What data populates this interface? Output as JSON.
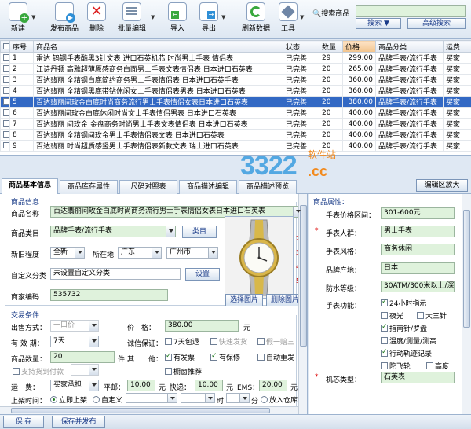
{
  "toolbar": {
    "buttons": [
      {
        "label": "新建",
        "icon": "new-icon"
      },
      {
        "label": "发布商品",
        "icon": "publish-icon"
      },
      {
        "label": "删除",
        "icon": "delete-icon"
      },
      {
        "label": "批量编辑",
        "icon": "batch-edit-icon"
      },
      {
        "label": "导入",
        "icon": "import-icon"
      },
      {
        "label": "导出",
        "icon": "export-icon"
      },
      {
        "label": "刷新数据",
        "icon": "refresh-icon"
      },
      {
        "label": "工具",
        "icon": "tools-icon"
      }
    ],
    "search_label": "搜索商品",
    "search_value": "",
    "search_button": "搜索",
    "advanced_search": "高级搜索"
  },
  "grid": {
    "columns": [
      "序号",
      "商品名",
      "状态",
      "数量",
      "价格",
      "商品分类",
      "运费"
    ],
    "rows": [
      {
        "no": "1",
        "name": "雷达 钨钢手表酷黑3针文表  进口石英机芯 时尚男士手表 情侣表",
        "status": "已完善",
        "qty": "29",
        "price": "299.00",
        "cat": "品牌手表/流行手表",
        "ship": "买家"
      },
      {
        "no": "2",
        "name": "江诗丹顿 高雅超薄原感商务白面男士手表文表情侣表 日本进口石英表",
        "status": "已完善",
        "qty": "20",
        "price": "265.00",
        "cat": "品牌手表/流行手表",
        "ship": "买家"
      },
      {
        "no": "3",
        "name": "百达翡丽 全精钢白底简约商务男士手表情侣表 日本进口石英手表",
        "status": "已完善",
        "qty": "20",
        "price": "360.00",
        "cat": "品牌手表/流行手表",
        "ship": "买家"
      },
      {
        "no": "4",
        "name": "百达翡丽 全精钢黑底带钻休闲女士手表情侣表男表 日本进口石英表",
        "status": "已完善",
        "qty": "20",
        "price": "360.00",
        "cat": "品牌手表/流行手表",
        "ship": "买家"
      },
      {
        "no": "5",
        "name": "百达翡丽间玫金白底时尚商务流行男士手表情侣女表日本进口石英表",
        "status": "已完善",
        "qty": "20",
        "price": "380.00",
        "cat": "品牌手表/流行手表",
        "ship": "买家"
      },
      {
        "no": "6",
        "name": "百达翡丽间玫金白底休闲时尚文士手表情侣男表 日本进口石英表",
        "status": "已完善",
        "qty": "20",
        "price": "400.00",
        "cat": "品牌手表/流行手表",
        "ship": "买家"
      },
      {
        "no": "7",
        "name": "百达翡丽 间玫金 金盘商务时尚男士手表文表情侣表 日本进口石英表",
        "status": "已完善",
        "qty": "20",
        "price": "400.00",
        "cat": "品牌手表/流行手表",
        "ship": "买家"
      },
      {
        "no": "8",
        "name": "百达翡丽 全精钢间玫金男士手表情侣表文表 日本进口石英表",
        "status": "已完善",
        "qty": "20",
        "price": "400.00",
        "cat": "品牌手表/流行手表",
        "ship": "买家"
      },
      {
        "no": "9",
        "name": "百达翡丽 时尚超质感竖男士手表情侣表新款文表 瑞士进口石英表",
        "status": "已完善",
        "qty": "20",
        "price": "400.00",
        "cat": "品牌手表/流行手表",
        "ship": "买家"
      }
    ]
  },
  "watermark": {
    "big": "3322",
    "dot": ".cc",
    "small": "软件站"
  },
  "tabs": [
    "商品基本信息",
    "商品库存属性",
    "尺码对照表",
    "商品描述编辑",
    "商品描述预览"
  ],
  "editor_zoom": "编辑区放大",
  "basic": {
    "section_title": "商品信息",
    "name_label": "商品名称",
    "name_value": "百达翡丽间玫金白底时尚商务流行男士手表情侣女表日本进口石英表",
    "category_label": "商品类目",
    "category_value": "品牌手表/流行手表",
    "category_button": "类目",
    "condition_label": "新旧程度",
    "condition_value": "全新",
    "location_label": "所在地",
    "province": "广东",
    "city": "广州市",
    "custom_cat_label": "自定义分类",
    "custom_cat_value": "未设置自定义分类",
    "set_button": "设置",
    "merchant_code_label": "商家编码",
    "merchant_code_value": "535732",
    "select_image": "选择图片",
    "delete_image": "删除图片",
    "thumb_nums": [
      "1",
      "2",
      "3",
      "4",
      "5"
    ]
  },
  "trade": {
    "section_title": "交易条件",
    "sale_type_label": "出售方式：",
    "sale_type_value": "一口价",
    "price_label": "价　格：",
    "price_value": "380.00",
    "price_unit": "元",
    "validity_label": "有 效 期：",
    "validity_value": "7天",
    "guarantee_label": "诚信保证：",
    "seven_day": "7天包退",
    "fast_ship": "快速发货",
    "fake_one": "假一赔三",
    "qty_label": "商品数量：",
    "qty_value": "20",
    "qty_unit": "件",
    "other_label": "其　　他：",
    "invoice": "有发票",
    "warranty": "有保修",
    "auto_relist": "自动重发",
    "pay_label": "支持货到付款",
    "showcase": "橱窗推荐",
    "freight_label": "运　费：",
    "freight_value": "买家承担",
    "mail_label": "平邮：",
    "mail_value": "10.00",
    "mail_unit": "元",
    "express_label": "快递：",
    "express_value": "10.00",
    "express_unit": "元",
    "ems_label": "EMS：",
    "ems_value": "20.00",
    "ems_unit": "元",
    "listing_label": "上架时间：",
    "listing_now": "立即上架",
    "listing_custom": "自定义",
    "listing_hour_unit": "时",
    "listing_min_unit": "分",
    "listing_warehouse": "放入仓库"
  },
  "attrs": {
    "section_title": "商品属性：",
    "price_range_label": "手表价格区间：",
    "price_range_value": "301-600元",
    "crowd_label": "手表人群：",
    "crowd_value": "男士手表",
    "style_label": "手表风格：",
    "style_value": "商务休闲",
    "origin_label": "品牌产地：",
    "origin_value": "日本",
    "waterproof_label": "防水等级：",
    "waterproof_value": "30ATM/300米以上/深",
    "func_label": "手表功能：",
    "funcs": [
      {
        "t": "24小时指示",
        "on": true
      },
      {
        "t": "夜光",
        "on": false
      },
      {
        "t": "大三针",
        "on": false
      },
      {
        "t": "指南针/罗盘",
        "on": true
      },
      {
        "t": "温度/测量/测高",
        "on": false
      },
      {
        "t": "行动轨迹记录",
        "on": true
      },
      {
        "t": "陀飞轮",
        "on": false
      },
      {
        "t": "高度",
        "on": false
      }
    ],
    "movement_label": "机芯类型：",
    "movement_value": "石英表"
  },
  "bottom": {
    "save": "保 存",
    "save_publish": "保存并发布"
  },
  "colors": {
    "selected_row": "#3369c4",
    "field_green": "#dff2dc",
    "accent": "#1b3c8a"
  }
}
